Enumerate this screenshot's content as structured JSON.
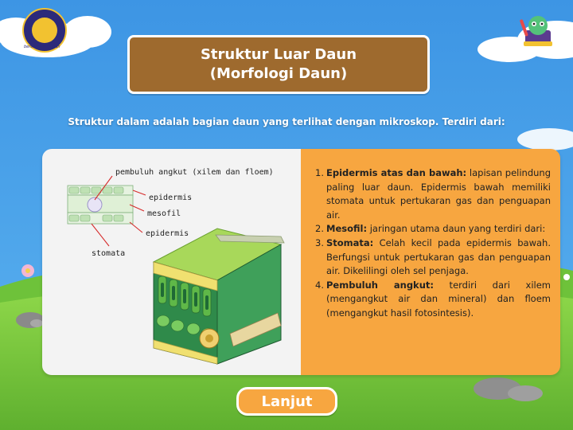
{
  "logo": {
    "caption": "bersama Wujudan"
  },
  "header": {
    "title_line1": "Struktur Luar Daun",
    "title_line2": "(Morfologi Daun)"
  },
  "intro": "Struktur dalam adalah bagian daun yang terlihat dengan mikroskop. Terdiri dari:",
  "diagram": {
    "labels": {
      "pembuluh": "pembuluh angkut (xilem dan floem)",
      "epidermis_top": "epidermis",
      "mesofil": "mesofil",
      "epidermis_bottom": "epidermis",
      "stomata": "stomata"
    }
  },
  "items": [
    {
      "num": "1.",
      "term": "Epidermis atas dan bawah:",
      "desc": " lapisan pelindung paling luar daun. Epidermis bawah memiliki stomata untuk pertukaran gas dan penguapan air."
    },
    {
      "num": "2.",
      "term": "Mesofil:",
      "desc": " jaringan utama daun yang terdiri dari:"
    },
    {
      "num": "3.",
      "term": "Stomata:",
      "desc": " Celah kecil pada epidermis bawah. Berfungsi untuk pertukaran gas dan penguapan air. Dikelilingi oleh sel penjaga."
    },
    {
      "num": "4.",
      "term": "Pembuluh angkut:",
      "desc": " terdiri dari xilem (mengangkut air dan mineral) dan floem (mengangkut hasil fotosintesis)."
    }
  ],
  "button": {
    "label": "Lanjut"
  },
  "colors": {
    "sky": "#3f9be6",
    "grass": "#7ccd3e",
    "title_bg": "#9e6a2e",
    "accent_orange": "#f7a640",
    "panel_light": "#f3f3f3"
  }
}
